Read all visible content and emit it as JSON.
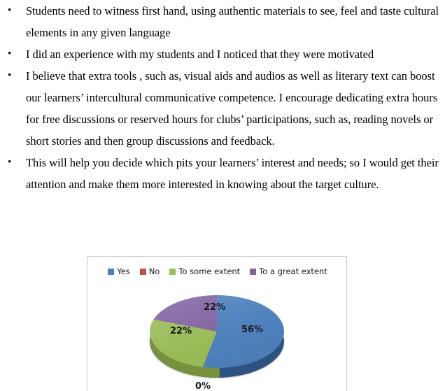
{
  "document": {
    "bullets": [
      {
        "marker": "•",
        "text": "Students need to witness first hand, using authentic materials to see, feel and taste cultural elements in any given language"
      },
      {
        "marker": "•",
        "text": "I did an experience with my students and I noticed that they were motivated"
      },
      {
        "marker": "•",
        "text": "I believe that extra tools , such as, visual aids and audios as well as literary text can boost our learners’ intercultural communicative competence. I encourage dedicating extra hours for free discussions or reserved hours for clubs’ participations, such as, reading novels or short stories and then group discussions and feedback."
      },
      {
        "marker": "•",
        "text": "This will help you decide which pits your learners’ interest and needs; so I would get their attention and make them more interested in knowing about the target culture."
      }
    ]
  },
  "chart_data": {
    "type": "pie",
    "title": "",
    "legend_position": "top",
    "three_d": true,
    "categories": [
      "Yes",
      "No",
      "To some extent",
      "To a great extent"
    ],
    "values": [
      56,
      0,
      22,
      22
    ],
    "value_labels": [
      "56%",
      "0%",
      "22%",
      "22%"
    ],
    "colors": [
      "#4e81bd",
      "#c0504d",
      "#9bbb59",
      "#8064a2"
    ],
    "depth_colors": [
      "#2e5280",
      "#8a3734",
      "#77913f",
      "#5a4673"
    ],
    "units": "percent"
  }
}
